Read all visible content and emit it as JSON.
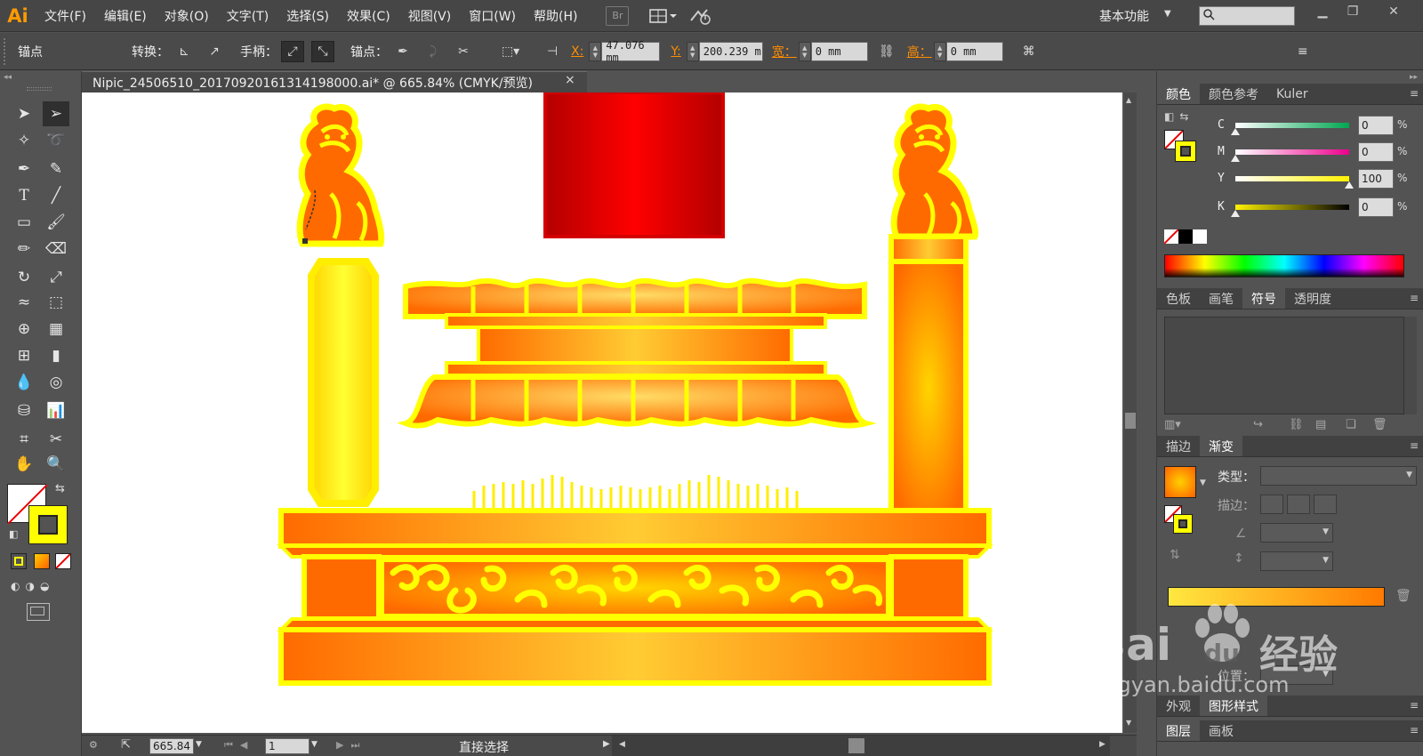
{
  "app": {
    "logo": "Ai",
    "menus": [
      "文件(F)",
      "编辑(E)",
      "对象(O)",
      "文字(T)",
      "选择(S)",
      "效果(C)",
      "视图(V)",
      "窗口(W)",
      "帮助(H)"
    ],
    "bridge_label": "Br",
    "workspace": "基本功能"
  },
  "control": {
    "mode": "锚点",
    "convert": "转换：",
    "handle": "手柄：",
    "anchor": "锚点：",
    "x_label": "X:",
    "x_value": "47.076 mm",
    "y_label": "Y:",
    "y_value": "200.239 m",
    "w_label": "宽：",
    "w_value": "0 mm",
    "h_label": "高：",
    "h_value": "0 mm"
  },
  "document": {
    "tab_title": "Nipic_24506510_20170920161314198000.ai* @ 665.84% (CMYK/预览)",
    "close_glyph": "×"
  },
  "status": {
    "zoom": "665.84",
    "artboard": "1",
    "tool": "直接选择"
  },
  "color_panel": {
    "tabs": [
      "颜色",
      "颜色参考",
      "Kuler"
    ],
    "active_tab": "颜色",
    "channels": [
      {
        "label": "C",
        "value": "0",
        "level": 0,
        "from": "#ffffff",
        "to": "#00a651"
      },
      {
        "label": "M",
        "value": "0",
        "level": 0,
        "from": "#ffffff",
        "to": "#ec008c"
      },
      {
        "label": "Y",
        "value": "100",
        "level": 1,
        "from": "#ffffff",
        "to": "#fff200"
      },
      {
        "label": "K",
        "value": "0",
        "level": 0,
        "from": "#fff200",
        "to": "#000000"
      }
    ],
    "pct": "%"
  },
  "swatch_panel": {
    "tabs": [
      "色板",
      "画笔",
      "符号",
      "透明度"
    ],
    "active_tab": "符号"
  },
  "gradient_panel": {
    "tabs": [
      "描边",
      "渐变"
    ],
    "active_tab": "渐变",
    "type_label": "类型：",
    "stroke_label": "描边：",
    "location_label": "位置："
  },
  "bottom_panels": {
    "row1": [
      "外观",
      "图形样式"
    ],
    "row2": [
      "图层",
      "画板"
    ]
  },
  "watermark": {
    "brand": "Bai",
    "brand2": "du",
    "cn": "经验",
    "url": "jingyan.baidu.com"
  },
  "colors": {
    "accent": "#ff8c00",
    "art_yellow": "#ffff00",
    "art_orange": "#ff6a00",
    "art_red": "#d40000"
  }
}
